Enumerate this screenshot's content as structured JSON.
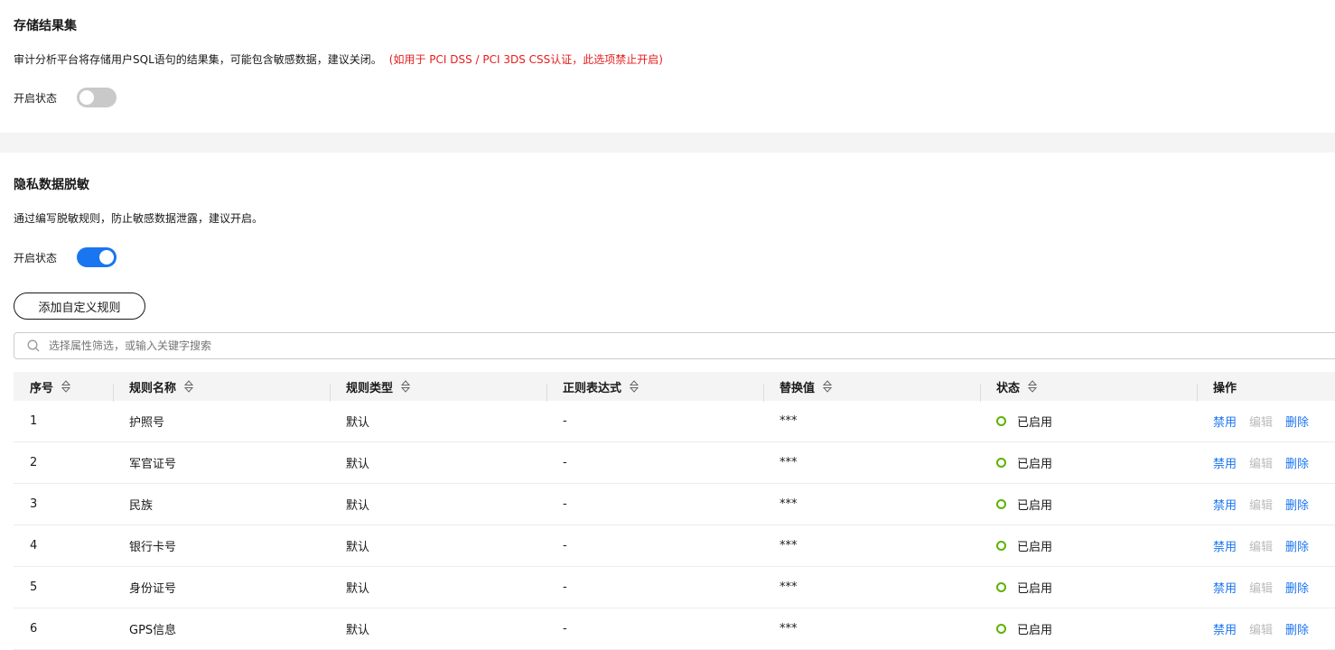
{
  "storage": {
    "title": "存储结果集",
    "description": "审计分析平台将存储用户SQL语句的结果集，可能包含敏感数据，建议关闭。",
    "warning": "(如用于 PCI DSS / PCI 3DS CSS认证，此选项禁止开启)",
    "toggle_label": "开启状态",
    "toggle_on": false
  },
  "masking": {
    "title": "隐私数据脱敏",
    "description": "通过编写脱敏规则，防止敏感数据泄露，建议开启。",
    "toggle_label": "开启状态",
    "toggle_on": true,
    "add_button": "添加自定义规则",
    "search_placeholder": "选择属性筛选，或输入关键字搜索"
  },
  "table": {
    "headers": [
      "序号",
      "规则名称",
      "规则类型",
      "正则表达式",
      "替换值",
      "状态",
      "操作"
    ],
    "rows": [
      {
        "no": "1",
        "name": "护照号",
        "type": "默认",
        "regex": "-",
        "replace": "***",
        "status": "已启用"
      },
      {
        "no": "2",
        "name": "军官证号",
        "type": "默认",
        "regex": "-",
        "replace": "***",
        "status": "已启用"
      },
      {
        "no": "3",
        "name": "民族",
        "type": "默认",
        "regex": "-",
        "replace": "***",
        "status": "已启用"
      },
      {
        "no": "4",
        "name": "银行卡号",
        "type": "默认",
        "regex": "-",
        "replace": "***",
        "status": "已启用"
      },
      {
        "no": "5",
        "name": "身份证号",
        "type": "默认",
        "regex": "-",
        "replace": "***",
        "status": "已启用"
      },
      {
        "no": "6",
        "name": "GPS信息",
        "type": "默认",
        "regex": "-",
        "replace": "***",
        "status": "已启用"
      }
    ],
    "actions": {
      "disable": "禁用",
      "edit": "编辑",
      "delete": "删除"
    }
  },
  "colors": {
    "accent": "#1a75f0",
    "warning": "#e61c1c",
    "status_ok": "#5cb300"
  }
}
